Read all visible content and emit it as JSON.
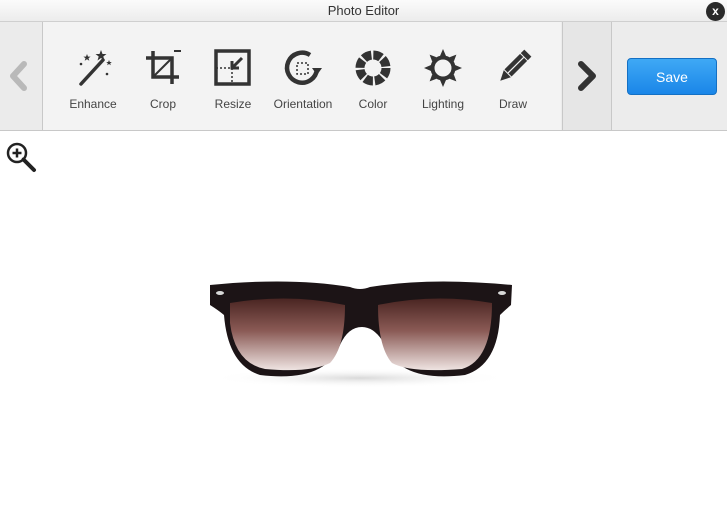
{
  "window": {
    "title": "Photo Editor",
    "close_label": "x"
  },
  "toolbar": {
    "tools": [
      {
        "label": "Enhance",
        "icon": "magic-wand-icon"
      },
      {
        "label": "Crop",
        "icon": "crop-icon"
      },
      {
        "label": "Resize",
        "icon": "resize-icon"
      },
      {
        "label": "Orientation",
        "icon": "rotate-icon"
      },
      {
        "label": "Color",
        "icon": "color-wheel-icon"
      },
      {
        "label": "Lighting",
        "icon": "sun-icon"
      },
      {
        "label": "Draw",
        "icon": "pencil-icon"
      }
    ],
    "prev_icon": "chevron-left-icon",
    "next_icon": "chevron-right-icon",
    "save_label": "Save"
  },
  "canvas": {
    "zoom_icon": "zoom-in-icon",
    "image": "sunglasses-photo"
  },
  "colors": {
    "accent": "#1a86e8",
    "toolbar_bg": "#ececec",
    "icon": "#333333"
  }
}
